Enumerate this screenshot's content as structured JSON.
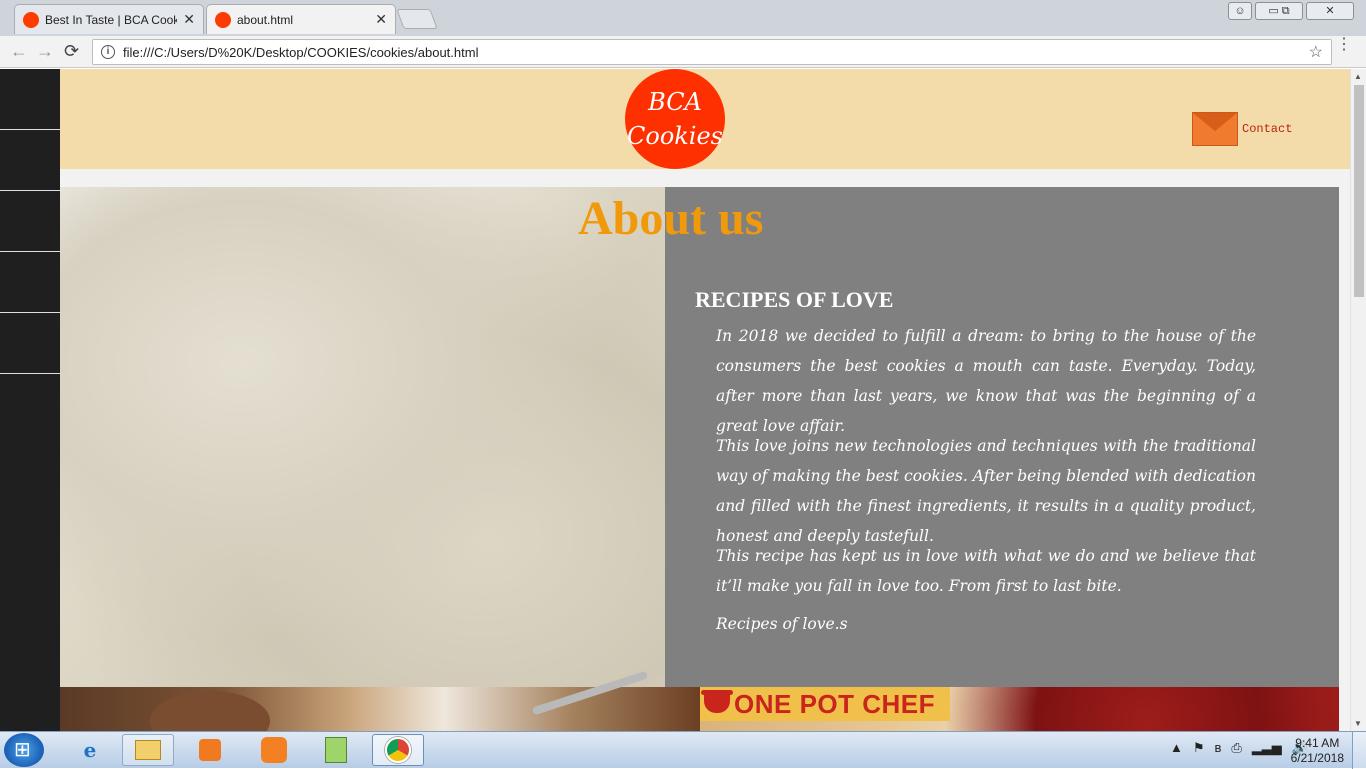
{
  "browser": {
    "tabs": [
      {
        "title": "Best In Taste | BCA Cooki",
        "close": "✕"
      },
      {
        "title": "about.html",
        "close": "✕"
      }
    ],
    "url": "file:///C:/Users/D%20K/Desktop/COOKIES/cookies/about.html",
    "back_icon": "←",
    "forward_icon": "→",
    "reload_icon": "⟳",
    "info_icon": "i",
    "star_icon": "☆",
    "menu_icon": "⋮"
  },
  "site": {
    "logo": {
      "line1": "BCA",
      "line2": "Cookies"
    },
    "contact_label": "Contact",
    "about_title": "About us",
    "heading": "RECIPES OF LOVE",
    "paragraphs": [
      "In 2018 we decided to fulfill a dream: to bring to the house of the consumers the best cookies a mouth can taste. Everyday. Today, after more than last years, we know that was the beginning of a great love affair.",
      "This love joins new technologies and techniques with the traditional way of making the best cookies. After being blended with dedication and filled with the finest ingredients, it results in a quality product, honest and deeply tastefull.",
      "This recipe has kept us in love with what we do and we believe that it’ll make you fall in love too. From first to last bite.",
      "Recipes of love.s"
    ],
    "banner_text": "ONE POT CHEF",
    "colors": {
      "header_bg": "#f3dcaa",
      "logo": "#ff3000",
      "title": "#f0990a",
      "panel": "#808080",
      "sidenav": "#1f1f1f"
    }
  },
  "taskbar": {
    "apps": [
      "internet-explorer-icon",
      "file-explorer-icon",
      "media-player-icon",
      "xampp-icon",
      "notepad-plus-icon",
      "chrome-icon"
    ],
    "tray_icons": [
      "▲",
      "⚑",
      "ʙ",
      "⎙",
      "▂▃▅",
      "🔊"
    ],
    "time": "9:41 AM",
    "date": "6/21/2018"
  }
}
